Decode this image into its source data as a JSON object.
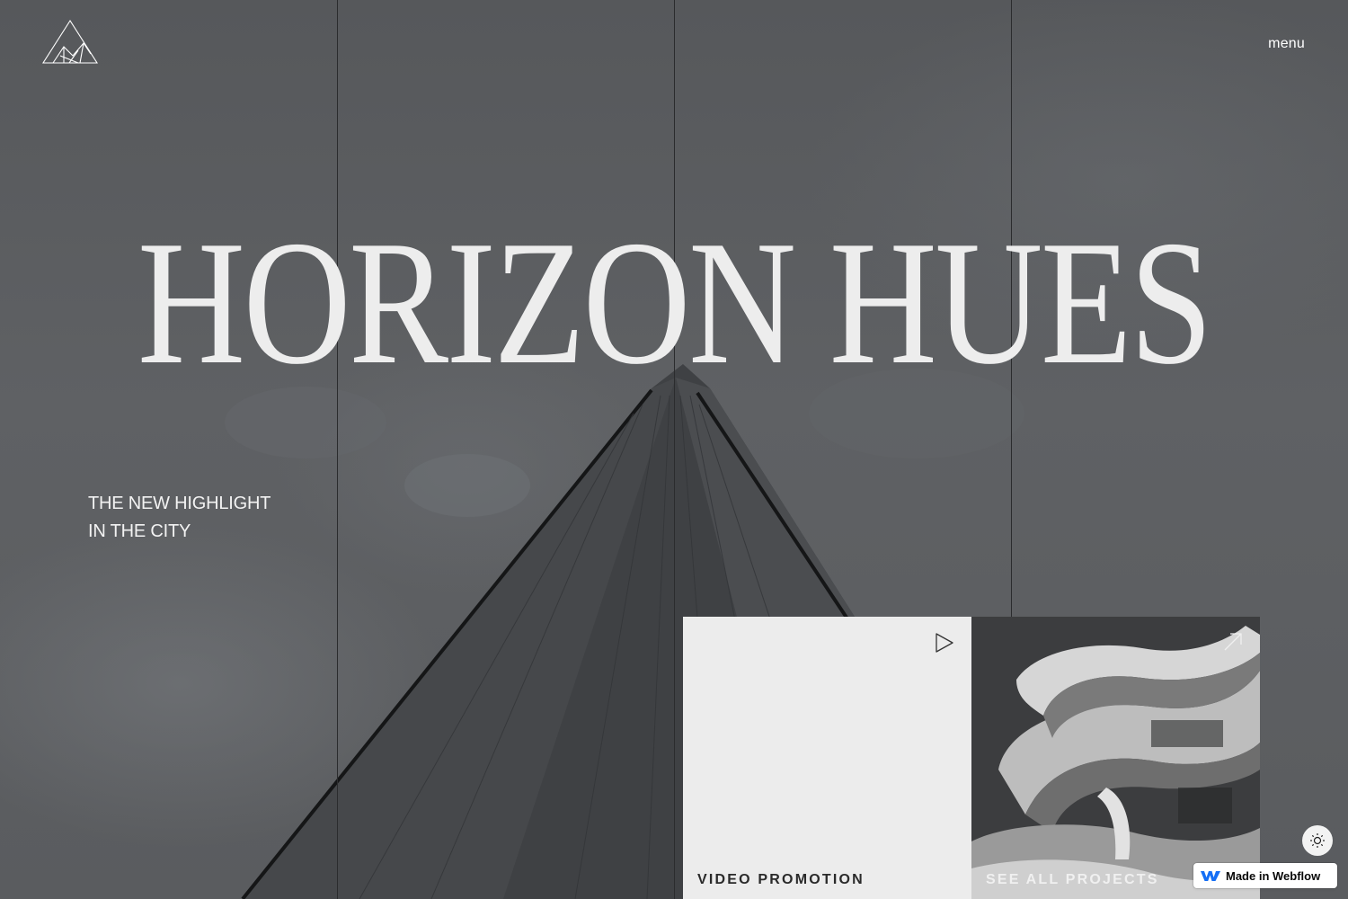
{
  "header": {
    "logo_icon": "triangle-mountain-logo-icon",
    "menu_label": "menu"
  },
  "hero": {
    "title": "HORIZON HUES",
    "tagline_line1": "THE NEW HIGHLIGHT",
    "tagline_line2": "IN THE CITY"
  },
  "cards": {
    "video": {
      "label": "VIDEO PROMOTION",
      "icon": "play-icon"
    },
    "projects": {
      "label": "SEE ALL PROJECTS",
      "icon": "arrow-up-right-icon"
    }
  },
  "theme_toggle": {
    "icon": "sun-icon"
  },
  "badge": {
    "label": "Made in Webflow",
    "icon": "webflow-logo-icon"
  },
  "colors": {
    "title_text": "#ededed",
    "video_card_bg": "#ececec",
    "background": "#5b5d60"
  }
}
